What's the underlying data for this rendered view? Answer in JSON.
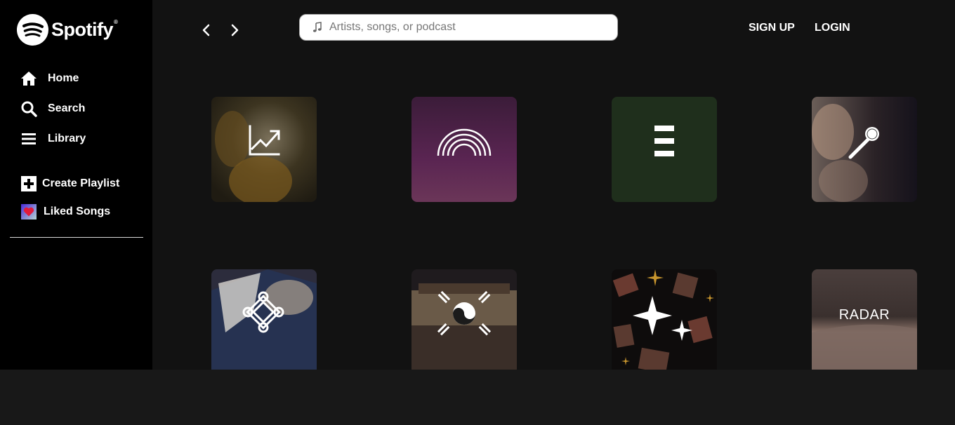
{
  "brand": {
    "name": "Spotify",
    "reg_mark": "®"
  },
  "sidebar": {
    "nav": [
      {
        "label": "Home",
        "icon": "home-icon"
      },
      {
        "label": "Search",
        "icon": "search-icon"
      },
      {
        "label": "Library",
        "icon": "library-icon"
      }
    ],
    "actions": [
      {
        "label": "Create Playlist",
        "icon": "plus-icon"
      },
      {
        "label": "Liked Songs",
        "icon": "heart-icon"
      }
    ]
  },
  "header": {
    "search_placeholder": "Artists, songs, or podcast",
    "signup_label": "SIGN UP",
    "login_label": "LOGIN"
  },
  "cards": [
    {
      "name": "charts-card",
      "icon": "trending-up-icon",
      "color": "#4a3a1a"
    },
    {
      "name": "rainbow-card",
      "icon": "rainbow-icon",
      "color": "#4a1f44"
    },
    {
      "name": "equalizer-card",
      "icon": "bars-icon",
      "color": "#1f2f1c"
    },
    {
      "name": "karaoke-card",
      "icon": "microphone-icon",
      "color": "#2a2226"
    },
    {
      "name": "knot-card",
      "icon": "endless-knot-icon",
      "color": "#3a3a5a"
    },
    {
      "name": "korea-card",
      "icon": "taegeuk-icon",
      "color": "#3a2e28"
    },
    {
      "name": "sparkles-card",
      "icon": "sparkles-icon",
      "color": "#0e0c0c"
    },
    {
      "name": "radar-card",
      "label": "RADAR",
      "color": "#6a5a55"
    }
  ]
}
